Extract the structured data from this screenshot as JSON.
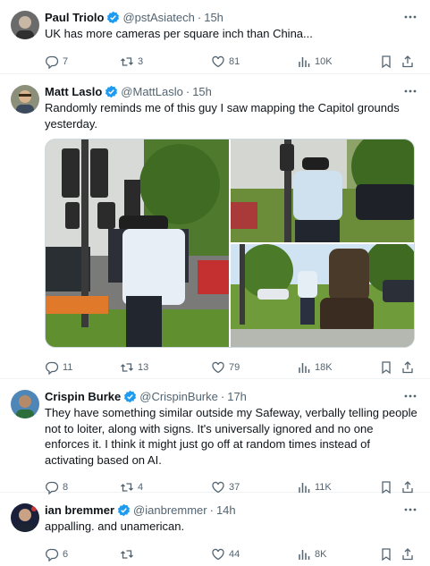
{
  "tweets": [
    {
      "name": "Paul Triolo",
      "handle": "@pstAsiatech",
      "time": "15h",
      "text": "UK has more cameras per square inch than China...",
      "replies": "7",
      "retweets": "3",
      "likes": "81",
      "views": "10K"
    },
    {
      "name": "Matt Laslo",
      "handle": "@MattLaslo",
      "time": "15h",
      "text": "Randomly reminds me of this guy I saw mapping the Capitol grounds yesterday.",
      "replies": "11",
      "retweets": "13",
      "likes": "79",
      "views": "18K"
    },
    {
      "name": "Crispin Burke",
      "handle": "@CrispinBurke",
      "time": "17h",
      "text": "They have something similar outside my Safeway, verbally telling people not to loiter, along with signs. It's universally ignored and no one enforces it. I think it might just go off at random times instead of activating based on AI.",
      "replies": "8",
      "retweets": "4",
      "likes": "37",
      "views": "11K"
    },
    {
      "name": "ian bremmer",
      "handle": "@ianbremmer",
      "time": "14h",
      "text": "appalling. and unamerican.",
      "replies": "6",
      "retweets": "",
      "likes": "44",
      "views": "8K"
    }
  ],
  "colors": {
    "verified": "#1d9bf0",
    "muted": "#536471",
    "text": "#0f1419"
  },
  "icons": [
    "verified-badge-icon",
    "more-icon",
    "reply-icon",
    "retweet-icon",
    "like-icon",
    "views-icon",
    "bookmark-icon",
    "share-icon"
  ]
}
